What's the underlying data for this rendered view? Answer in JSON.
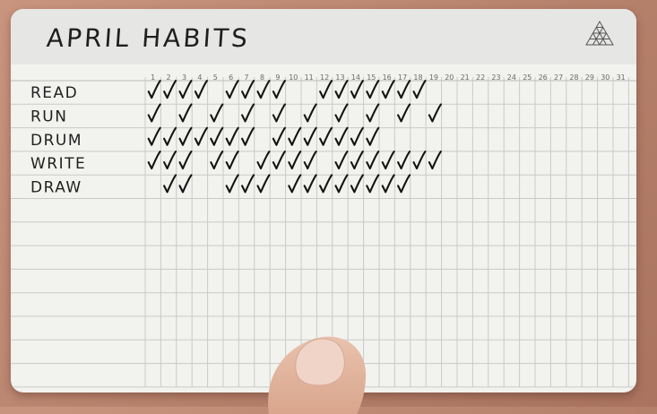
{
  "card": {
    "title": "APRIL HABITS",
    "logo_icon": "triangle-grid-icon"
  },
  "days": [
    "1",
    "2",
    "3",
    "4",
    "5",
    "6",
    "7",
    "8",
    "9",
    "10",
    "11",
    "12",
    "13",
    "14",
    "15",
    "16",
    "17",
    "18",
    "19",
    "20",
    "21",
    "22",
    "23",
    "24",
    "25",
    "26",
    "27",
    "28",
    "29",
    "30",
    "31"
  ],
  "habits": [
    {
      "label": "READ",
      "checked_days": [
        1,
        2,
        3,
        4,
        6,
        7,
        8,
        9,
        12,
        13,
        14,
        15,
        16,
        17,
        18
      ]
    },
    {
      "label": "RUN",
      "checked_days": [
        1,
        3,
        5,
        7,
        9,
        11,
        13,
        15,
        17,
        19
      ]
    },
    {
      "label": "DRUM",
      "checked_days": [
        1,
        2,
        3,
        4,
        5,
        6,
        7,
        9,
        10,
        11,
        12,
        13,
        14,
        15
      ]
    },
    {
      "label": "WRITE",
      "checked_days": [
        1,
        2,
        3,
        5,
        6,
        8,
        9,
        10,
        11,
        13,
        14,
        15,
        16,
        17,
        18,
        19
      ]
    },
    {
      "label": "DRAW",
      "checked_days": [
        2,
        3,
        6,
        7,
        8,
        10,
        11,
        12,
        13,
        14,
        15,
        16,
        17
      ]
    }
  ],
  "colors": {
    "card": "#f2f2ef",
    "header": "#e6e7e5",
    "ink": "#141414",
    "background": "#b7826c"
  }
}
